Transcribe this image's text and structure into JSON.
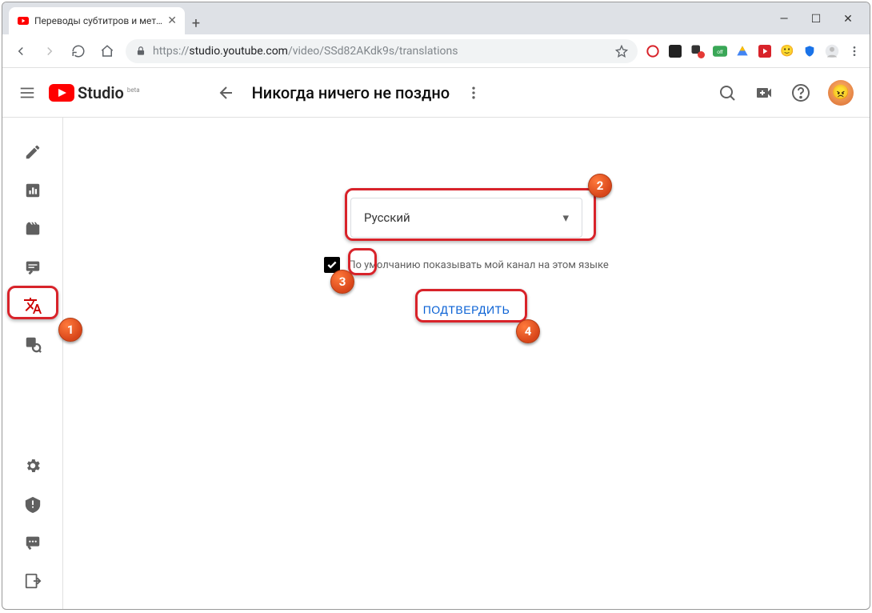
{
  "window": {
    "tab_title": "Переводы субтитров и метадан",
    "controls": {
      "minimize": "—",
      "maximize": "☐",
      "close": "✕"
    }
  },
  "address": {
    "url_prefix": "https://",
    "url_host": "studio.youtube.com",
    "url_path": "/video/SSd82AKdk9s/translations"
  },
  "header": {
    "logo_text": "Studio",
    "logo_beta": "beta",
    "video_title": "Никогда ничего не поздно"
  },
  "sidebar": {
    "items": [
      {
        "name": "details",
        "icon": "pencil"
      },
      {
        "name": "analytics",
        "icon": "chart"
      },
      {
        "name": "editor",
        "icon": "clapper"
      },
      {
        "name": "comments",
        "icon": "comment"
      },
      {
        "name": "translations",
        "icon": "translate",
        "active": true
      },
      {
        "name": "settings-sub",
        "icon": "search-settings"
      }
    ],
    "bottom_items": [
      {
        "name": "settings",
        "icon": "gear"
      },
      {
        "name": "feedback",
        "icon": "alert"
      },
      {
        "name": "whats-new",
        "icon": "chat"
      },
      {
        "name": "creator-classic",
        "icon": "exit"
      }
    ]
  },
  "main": {
    "language_selected": "Русский",
    "checkbox_label": "По умолчанию показывать мой канал на этом языке",
    "checkbox_checked": true,
    "confirm_label": "ПОДТВЕРДИТЬ"
  },
  "annotations": {
    "b1": "1",
    "b2": "2",
    "b3": "3",
    "b4": "4"
  }
}
